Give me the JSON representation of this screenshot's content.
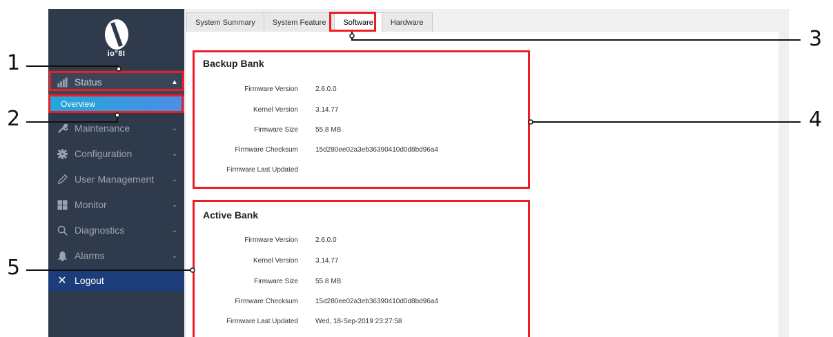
{
  "sidebar": {
    "logo_text": "io°8I",
    "items": [
      {
        "label": "Status",
        "icon": "chart-icon"
      },
      {
        "label": "Maintenance",
        "icon": "wrench-icon"
      },
      {
        "label": "Configuration",
        "icon": "gear-icon"
      },
      {
        "label": "User Management",
        "icon": "pencil-icon"
      },
      {
        "label": "Monitor",
        "icon": "grid-icon"
      },
      {
        "label": "Diagnostics",
        "icon": "search-icon"
      },
      {
        "label": "Alarms",
        "icon": "bell-icon"
      }
    ],
    "status_sub": "Overview",
    "logout": "Logout"
  },
  "tabs": [
    "System Summary",
    "System Feature",
    "Software",
    "Hardware"
  ],
  "active_tab": "Software",
  "backup_bank": {
    "title": "Backup Bank",
    "rows": [
      {
        "key": "Firmware Version",
        "value": "2.6.0.0"
      },
      {
        "key": "Kernel Version",
        "value": "3.14.77"
      },
      {
        "key": "Firmware Size",
        "value": "55.8 MB"
      },
      {
        "key": "Firmware Checksum",
        "value": "15d280ee02a3eb36390410d0d8bd96a4"
      },
      {
        "key": "Firmware Last Updated",
        "value": ""
      }
    ]
  },
  "active_bank": {
    "title": "Active Bank",
    "rows": [
      {
        "key": "Firmware Version",
        "value": "2.6.0.0"
      },
      {
        "key": "Kernel Version",
        "value": "3.14.77"
      },
      {
        "key": "Firmware Size",
        "value": "55.8 MB"
      },
      {
        "key": "Firmware Checksum",
        "value": "15d280ee02a3eb36390410d0d8bd96a4"
      },
      {
        "key": "Firmware Last Updated",
        "value": "Wed, 18-Sep-2019 23:27:58"
      }
    ]
  },
  "callouts": [
    "1",
    "2",
    "3",
    "4",
    "5"
  ],
  "colors": {
    "sidebar_bg": "#2f3b4c",
    "highlight_red": "#ee1c25",
    "overview_blue": "#22a7d8",
    "logout_blue": "#1c3d7a"
  }
}
